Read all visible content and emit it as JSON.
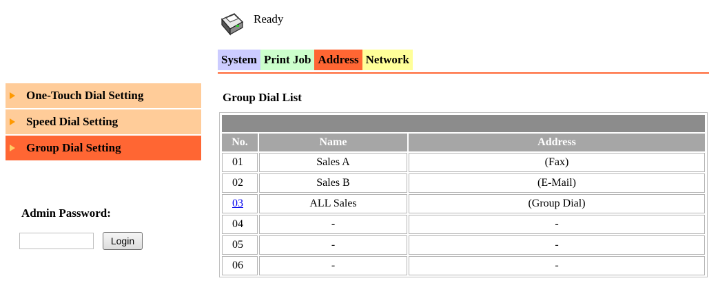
{
  "status": {
    "icon": "printer-icon",
    "text": "Ready"
  },
  "tabs": [
    {
      "label": "System"
    },
    {
      "label": "Print Job"
    },
    {
      "label": "Address"
    },
    {
      "label": "Network"
    }
  ],
  "sidebar": {
    "items": [
      {
        "label": "One-Touch Dial Setting"
      },
      {
        "label": "Speed Dial Setting"
      },
      {
        "label": "Group Dial Setting"
      }
    ]
  },
  "admin": {
    "label": "Admin Password:",
    "password_value": "",
    "login_label": "Login"
  },
  "list": {
    "title": "Group Dial List",
    "columns": [
      "No.",
      "Name",
      "Address"
    ],
    "rows": [
      {
        "no": "01",
        "name": "Sales A",
        "address": "(Fax)"
      },
      {
        "no": "02",
        "name": "Sales B",
        "address": "(E-Mail)"
      },
      {
        "no": "03",
        "name": "ALL Sales",
        "address": "(Group Dial)"
      },
      {
        "no": "04",
        "name": "-",
        "address": "-"
      },
      {
        "no": "05",
        "name": "-",
        "address": "-"
      },
      {
        "no": "06",
        "name": "-",
        "address": "-"
      }
    ]
  },
  "colors": {
    "accent": "#ff6633",
    "sidebar": "#ffcc99",
    "header": "#a6a6a6",
    "link": "#0000ee"
  }
}
